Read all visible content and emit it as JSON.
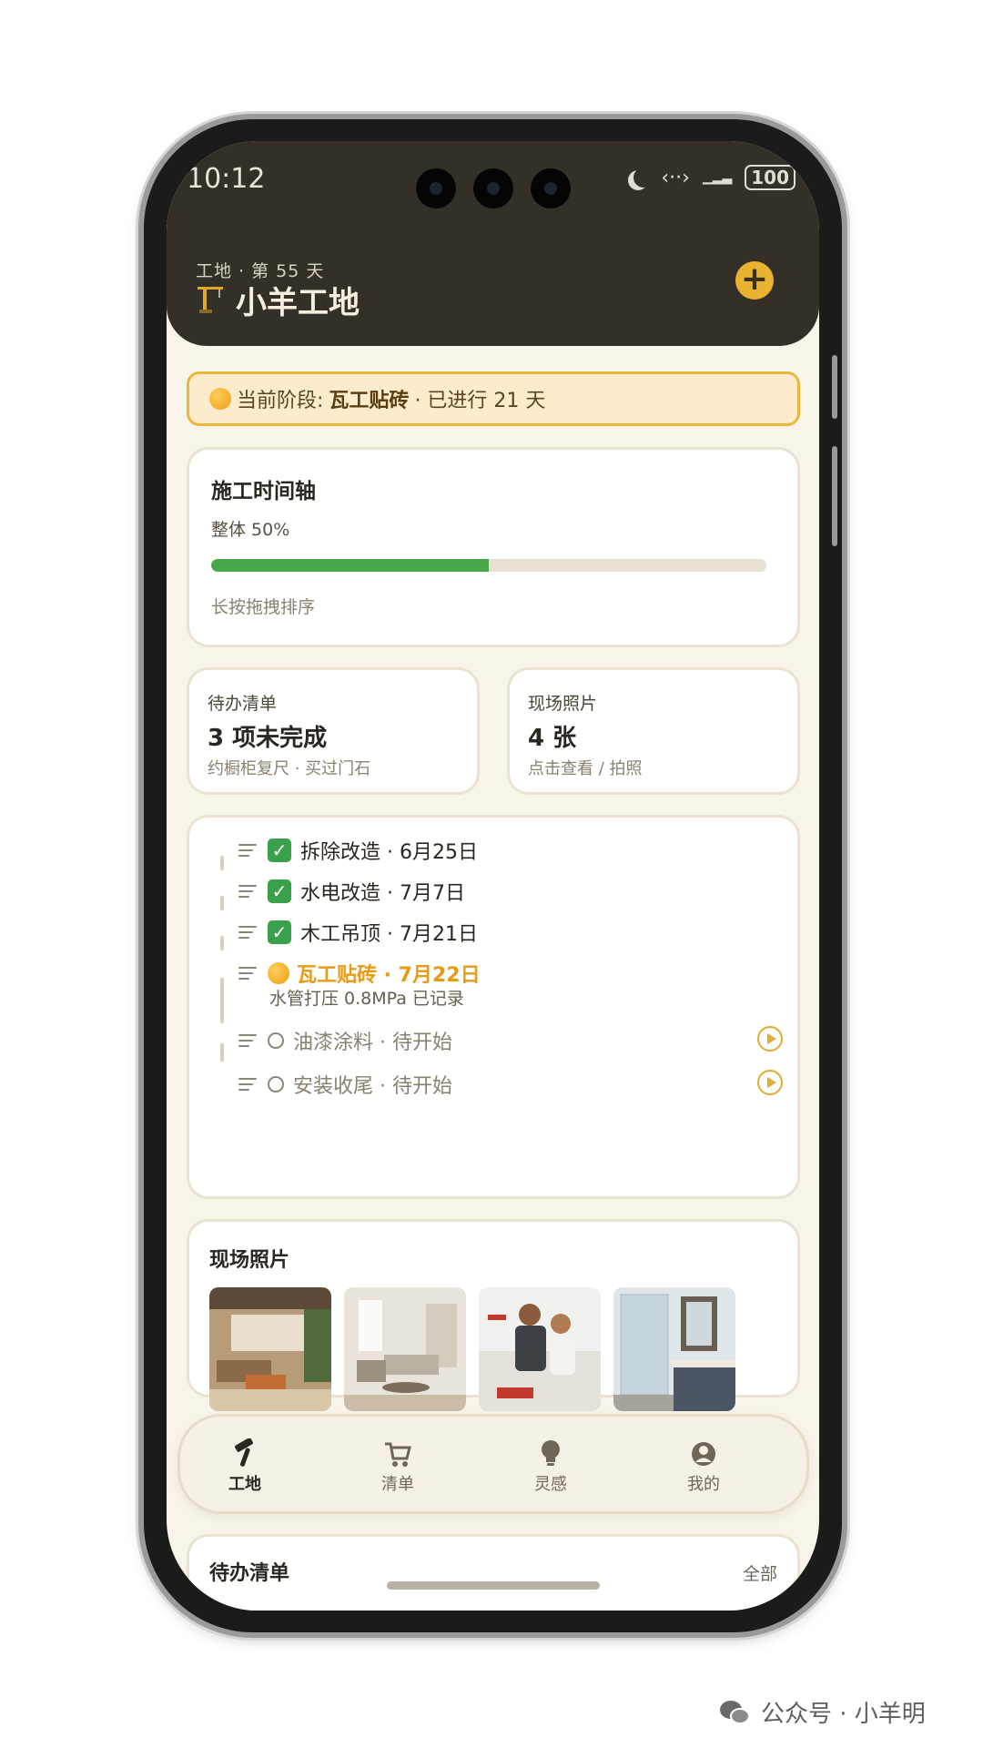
{
  "status_bar": {
    "time": "10:12",
    "battery": "100"
  },
  "header": {
    "subtitle": "工地 · 第 55 天",
    "title": "小羊工地",
    "add_icon": "plus-icon"
  },
  "stage": {
    "label": "当前阶段:",
    "name": "瓦工贴砖",
    "elapsed": "· 已进行 21 天"
  },
  "timeline": {
    "title": "施工时间轴",
    "overall": "整体 50%",
    "progress": 0.5,
    "hint": "长按拖拽排序"
  },
  "todo_summary": {
    "label": "待办清单",
    "value": "3 项未完成",
    "desc": "约橱柜复尺 · 买过门石"
  },
  "photo_summary": {
    "label": "现场照片",
    "value": "4 张",
    "desc": "点击查看 / 拍照"
  },
  "steps": [
    {
      "text": "拆除改造 · 6月25日",
      "status": "done"
    },
    {
      "text": "水电改造 · 7月7日",
      "status": "done"
    },
    {
      "text": "木工吊顶 · 7月21日",
      "status": "done"
    },
    {
      "text": "瓦工贴砖 · 7月22日",
      "status": "current",
      "note": "水管打压 0.8MPa 已记录"
    },
    {
      "text": "油漆涂料 · 待开始",
      "status": "pending"
    },
    {
      "text": "安装收尾 · 待开始",
      "status": "pending"
    }
  ],
  "photos": {
    "title": "现场照片"
  },
  "nav": [
    {
      "label": "工地",
      "icon": "hammer-icon",
      "active": true
    },
    {
      "label": "清单",
      "icon": "cart-icon",
      "active": false
    },
    {
      "label": "灵感",
      "icon": "lightbulb-icon",
      "active": false
    },
    {
      "label": "我的",
      "icon": "user-icon",
      "active": false
    }
  ],
  "todo_section": {
    "title": "待办清单",
    "all_link": "全部"
  },
  "watermark": "公众号 · 小羊明",
  "colors": {
    "accent": "#e9b230",
    "header_bg": "#353027",
    "progress": "#4aa84c",
    "page_bg": "#f8f4ea"
  }
}
